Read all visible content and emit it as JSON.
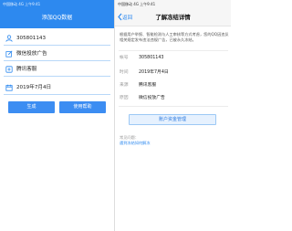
{
  "left": {
    "status_bar": "中国移动 4G 上午9:41",
    "title": "添加QQ数据",
    "fields": {
      "qq_number": "305801143",
      "ad_type": "微信投放广告",
      "source": "腾讯客服",
      "date": "2019年7月4日"
    },
    "buttons": {
      "generate": "生成",
      "use_help": "使用帮助"
    },
    "colors": {
      "accent": "#2d89ef",
      "button": "#3c8df2"
    }
  },
  "right": {
    "status_bar": "中国移动 4G 上午9:41",
    "back_label": "返回",
    "title": "了解冻结详情",
    "description": "根据用户举报、智能检测与人工审核等方式考虑，您的QQ因违反相关规定发布违法违规广告，已被永久冻结。",
    "rows": [
      {
        "key": "帐号",
        "value": "305801143"
      },
      {
        "key": "时间",
        "value": "2019年7月4日"
      },
      {
        "key": "来源",
        "value": "腾讯客服"
      },
      {
        "key": "原因",
        "value": "微信投放广告"
      }
    ],
    "manage_button": "账户资金管理",
    "help_title": "常见问题：",
    "help_link": "遇到冻结如何解冻"
  }
}
